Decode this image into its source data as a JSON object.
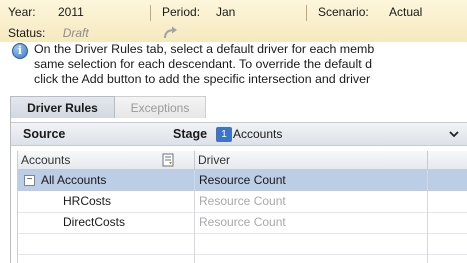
{
  "pov": {
    "year_label": "Year:",
    "year_value": "2011",
    "period_label": "Period:",
    "period_value": "Jan",
    "scenario_label": "Scenario:",
    "scenario_value": "Actual",
    "status_label": "Status:",
    "status_value": "Draft"
  },
  "info": {
    "lines": [
      "On the Driver Rules tab, select a default driver for each memb",
      "same selection for each descendant. To override the default d",
      "click the Add button to add the specific intersection and driver"
    ]
  },
  "tabs": [
    {
      "label": "Driver Rules",
      "active": true
    },
    {
      "label": "Exceptions",
      "active": false
    }
  ],
  "source": {
    "label": "Source",
    "stage_label": "Stage",
    "stage_number": "1",
    "stage_value": "Accounts"
  },
  "grid": {
    "columns": [
      "Accounts",
      "Driver"
    ],
    "rows": [
      {
        "account": "All Accounts",
        "driver": "Resource Count",
        "selected": true,
        "expandable": true,
        "expander": "−"
      },
      {
        "account": "HRCosts",
        "driver": "Resource Count",
        "selected": false
      },
      {
        "account": "DirectCosts",
        "driver": "Resource Count",
        "selected": false
      }
    ]
  },
  "colors": {
    "header_bg": "#f5e9bf",
    "selected_row": "#bccde6",
    "stage_badge": "#3d74c6"
  }
}
